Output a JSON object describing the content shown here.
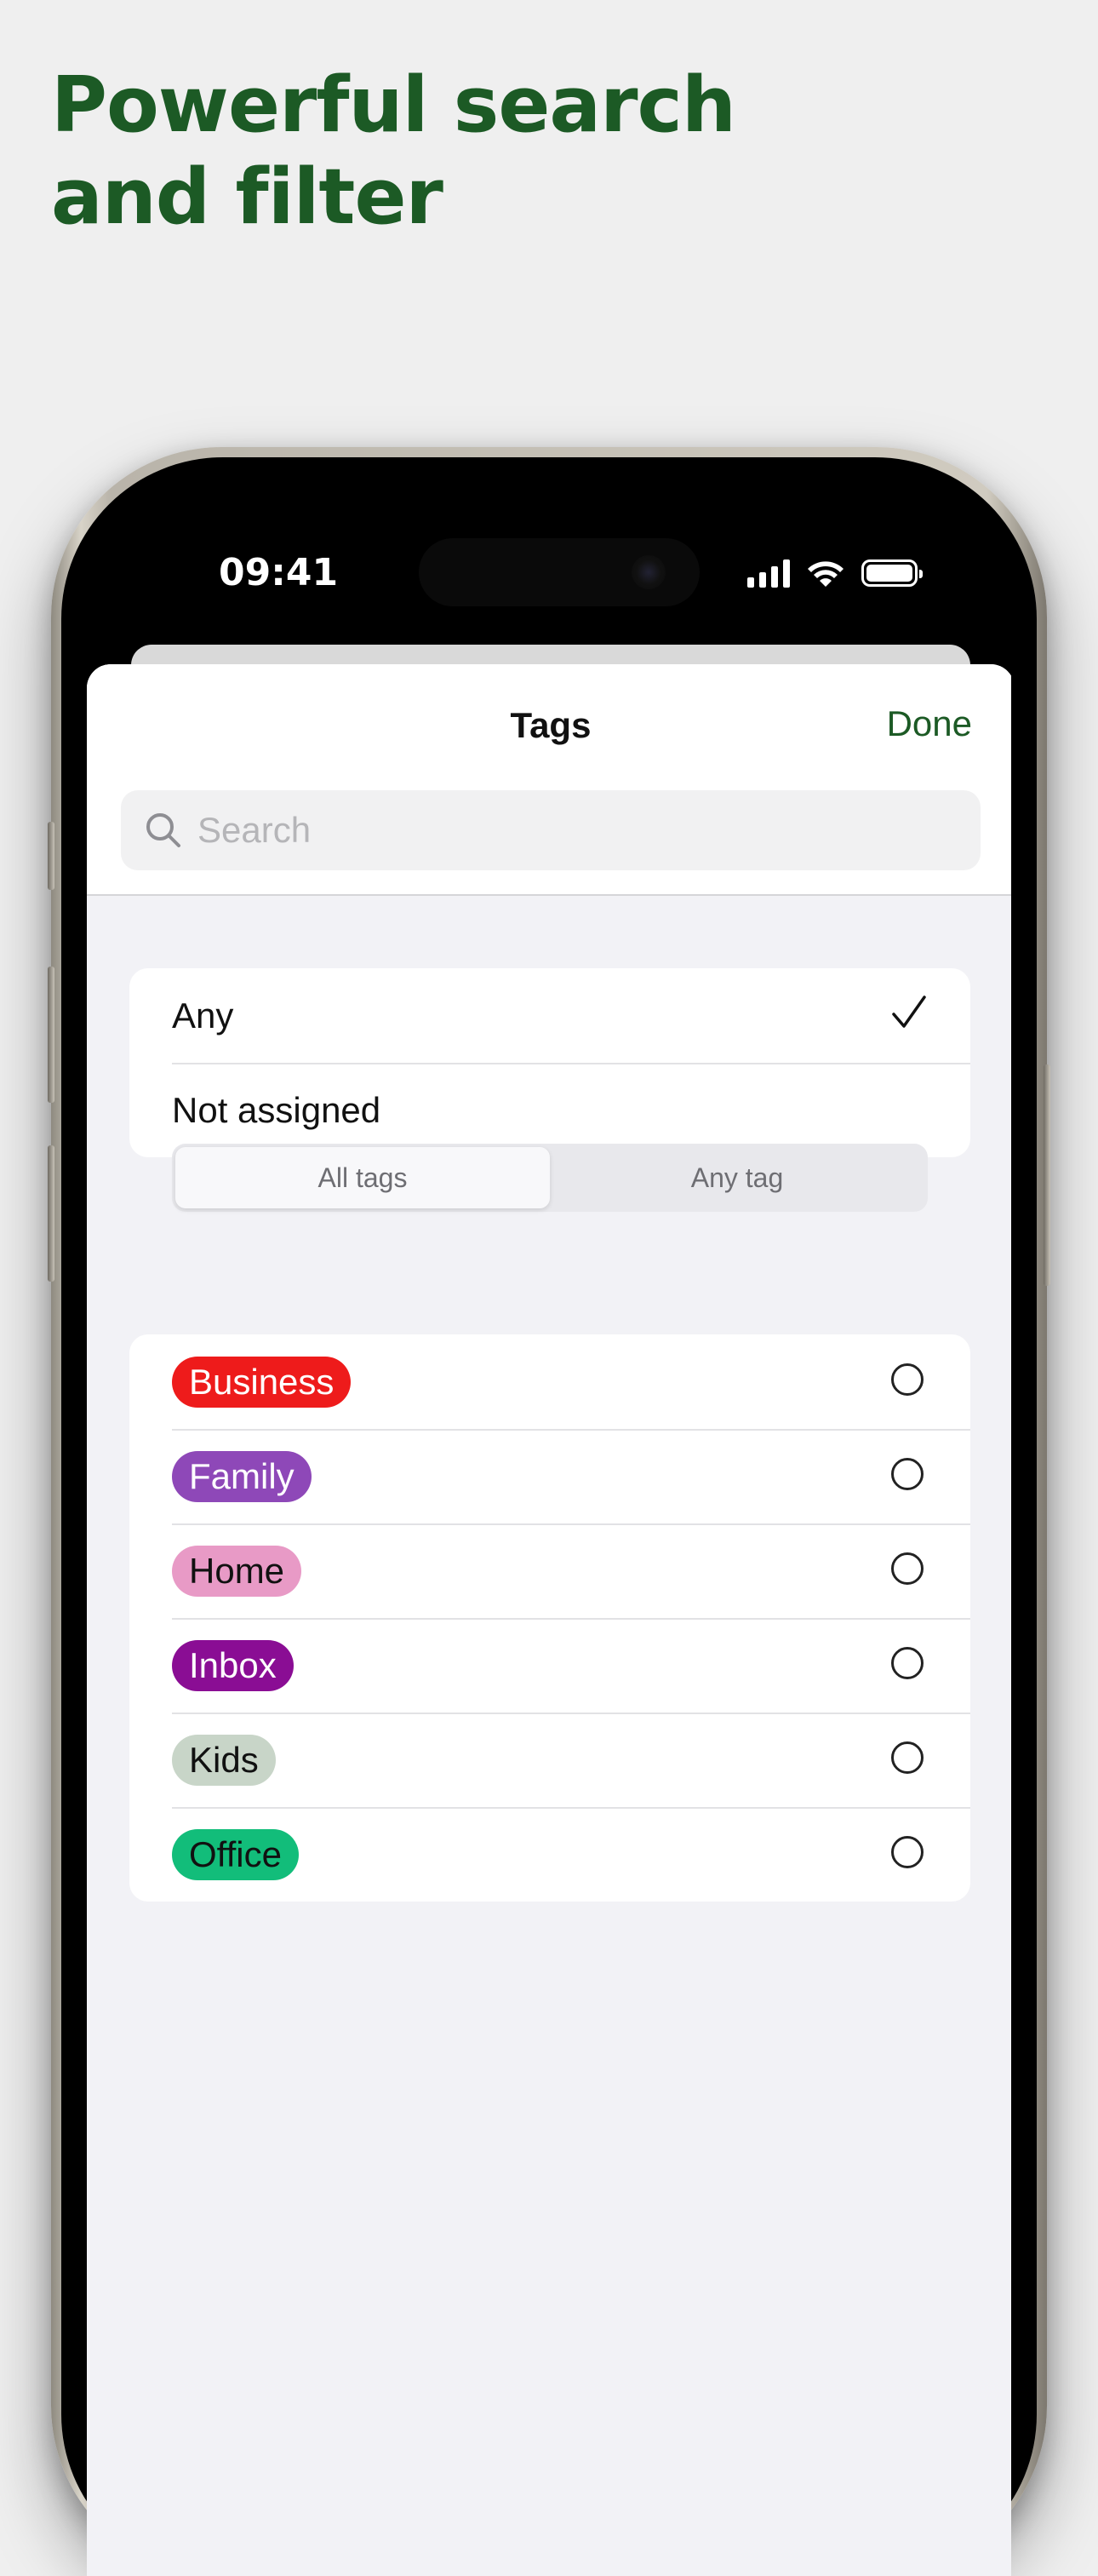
{
  "headline": {
    "line1": "Powerful search",
    "line2": "and filter"
  },
  "status_bar": {
    "time": "09:41",
    "icons": [
      "signal-icon",
      "wifi-icon",
      "battery-icon"
    ]
  },
  "nav": {
    "title": "Tags",
    "done_label": "Done"
  },
  "search": {
    "placeholder": "Search",
    "value": ""
  },
  "assignment": {
    "options": [
      {
        "label": "Any",
        "selected": true
      },
      {
        "label": "Not assigned",
        "selected": false
      }
    ]
  },
  "match_mode": {
    "options": [
      "All tags",
      "Any tag"
    ],
    "selected": "All tags"
  },
  "tags": [
    {
      "name": "Business",
      "color": "#ee1b1b",
      "text_color": "#ffffff",
      "selected": false
    },
    {
      "name": "Family",
      "color": "#8e48b8",
      "text_color": "#ffffff",
      "selected": false
    },
    {
      "name": "Home",
      "color": "#e89ac6",
      "text_color": "#111111",
      "selected": false
    },
    {
      "name": "Inbox",
      "color": "#8a0d94",
      "text_color": "#ffffff",
      "selected": false
    },
    {
      "name": "Kids",
      "color": "#c8d5c8",
      "text_color": "#111111",
      "selected": false
    },
    {
      "name": "Office",
      "color": "#12bd7a",
      "text_color": "#111111",
      "selected": false
    }
  ],
  "colors": {
    "accent": "#1c5a25",
    "background": "#efefef",
    "sheet_background": "#f2f2f6"
  }
}
